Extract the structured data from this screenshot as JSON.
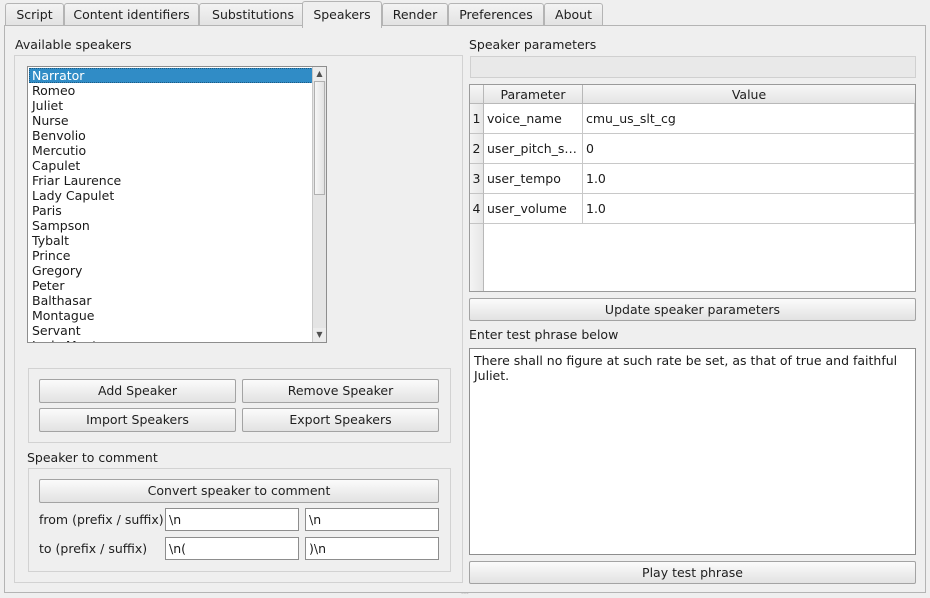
{
  "tabs": [
    {
      "label": "Script",
      "active": false
    },
    {
      "label": "Content identifiers",
      "active": false
    },
    {
      "label": "Substitutions",
      "active": false
    },
    {
      "label": "Speakers",
      "active": true
    },
    {
      "label": "Render",
      "active": false
    },
    {
      "label": "Preferences",
      "active": false
    },
    {
      "label": "About",
      "active": false
    }
  ],
  "left": {
    "available_label": "Available speakers",
    "speakers": [
      "Narrator",
      "Romeo",
      "Juliet",
      "Nurse",
      "Benvolio",
      "Mercutio",
      "Capulet",
      "Friar Laurence",
      "Lady Capulet",
      "Paris",
      "Sampson",
      "Tybalt",
      "Prince",
      "Gregory",
      "Peter",
      "Balthasar",
      "Montague",
      "Servant",
      "Lady Montague"
    ],
    "selected_speaker": "Narrator",
    "buttons": {
      "add": "Add Speaker",
      "remove": "Remove Speaker",
      "import": "Import Speakers",
      "export": "Export Speakers"
    },
    "comment_label": "Speaker to comment",
    "convert_button": "Convert speaker to comment",
    "from_label": "from (prefix / suffix)",
    "to_label": "to (prefix / suffix)",
    "from_prefix": "\\n",
    "from_suffix": "\\n",
    "to_prefix": "\\n(",
    "to_suffix": ")\\n"
  },
  "right": {
    "params_label": "Speaker parameters",
    "params_field": "",
    "table_headers": {
      "parameter": "Parameter",
      "value": "Value"
    },
    "rows": [
      {
        "num": "1",
        "param": "voice_name",
        "value": "cmu_us_slt_cg"
      },
      {
        "num": "2",
        "param": "user_pitch_s…",
        "value": "0"
      },
      {
        "num": "3",
        "param": "user_tempo",
        "value": "1.0"
      },
      {
        "num": "4",
        "param": "user_volume",
        "value": "1.0"
      }
    ],
    "update_button": "Update speaker parameters",
    "test_label": "Enter test phrase below",
    "test_phrase": "There shall no figure at such rate be set, as that of true and faithful Juliet.",
    "play_button": "Play test phrase"
  },
  "colors": {
    "selection": "#308cc6",
    "window_bg": "#efefef"
  }
}
